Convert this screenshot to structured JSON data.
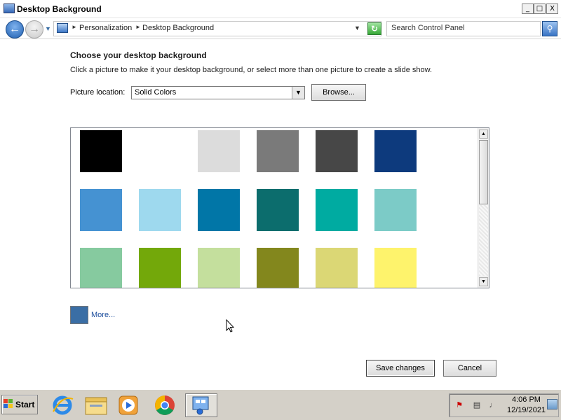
{
  "window": {
    "title": "Desktop Background",
    "buttons": {
      "minimize": "_",
      "maximize": "□",
      "close": "X"
    }
  },
  "address": {
    "breadcrumbs": [
      "Personalization",
      "Desktop Background"
    ],
    "search_placeholder": "Search Control Panel"
  },
  "content": {
    "heading": "Choose your desktop background",
    "subtext": "Click a picture to make it your desktop background, or select more than one picture to create a slide show.",
    "location_label": "Picture location:",
    "location_value": "Solid Colors",
    "browse_label": "Browse...",
    "more_label": "More...",
    "more_color": "#3a6ea5",
    "swatches": [
      [
        "#000000",
        "#ffffff",
        "#dcdcdc",
        "#7a7a7a",
        "#474747",
        "#0d3a7d"
      ],
      [
        "#4592d2",
        "#9ed9ee",
        "#0176a7",
        "#0c6d6d",
        "#00aba1",
        "#7ccbc7"
      ],
      [
        "#86ca9f",
        "#73a80a",
        "#c4df9d",
        "#83871d",
        "#dbd775",
        "#fef36c"
      ]
    ]
  },
  "footer": {
    "save_label": "Save changes",
    "cancel_label": "Cancel"
  },
  "taskbar": {
    "start_label": "Start",
    "time": "4:06 PM",
    "date": "12/19/2021",
    "apps": [
      "internet-explorer",
      "windows-explorer",
      "windows-media-player",
      "google-chrome",
      "control-panel"
    ]
  }
}
